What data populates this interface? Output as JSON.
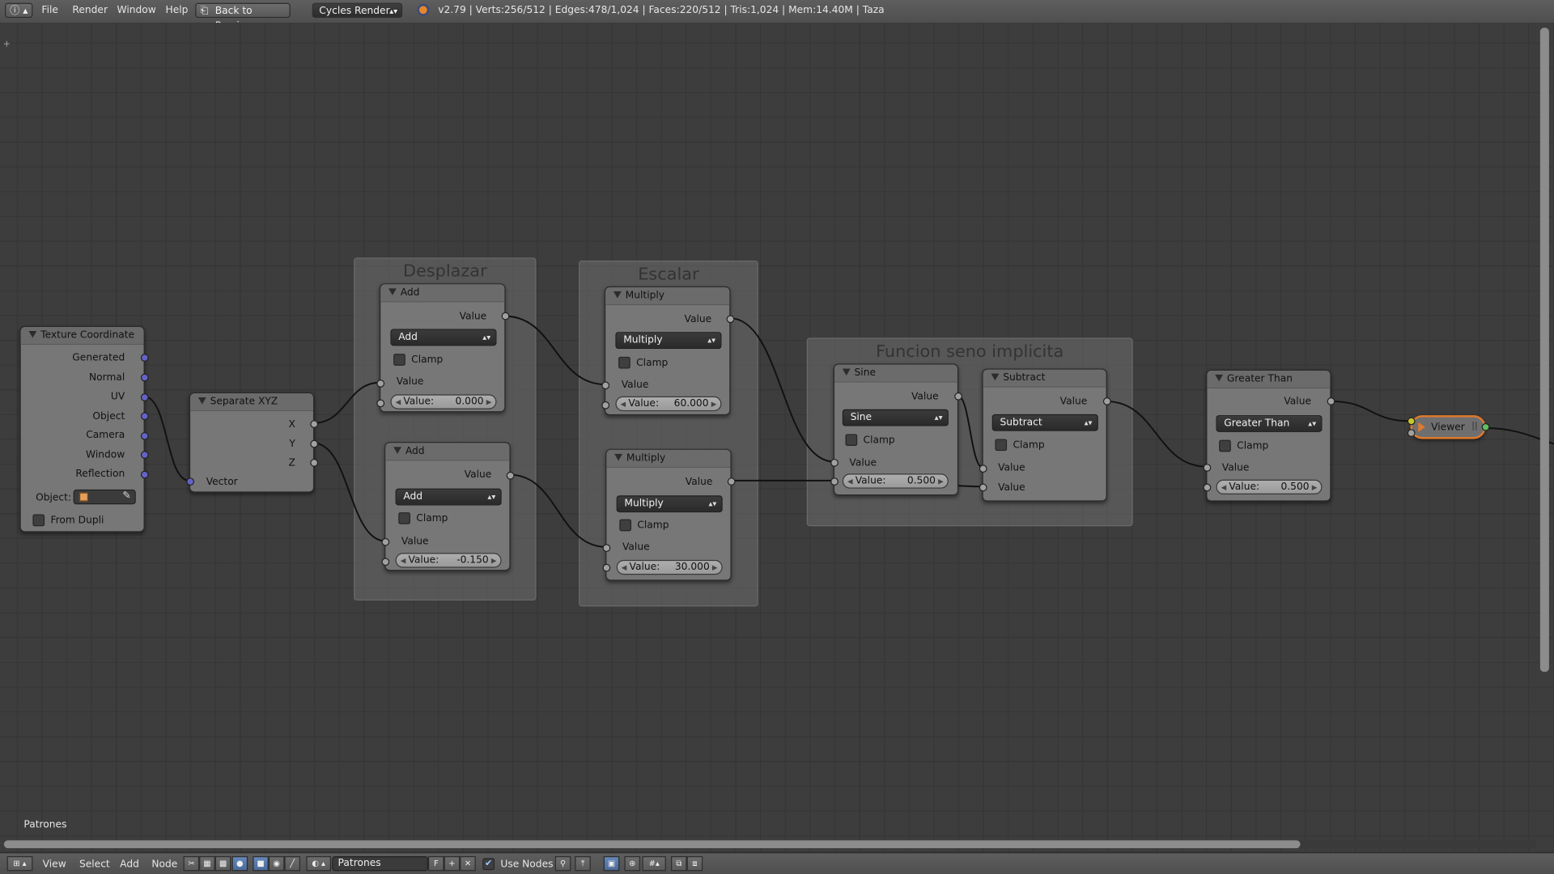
{
  "colors": {
    "canvas_bg": "#3d3d3d",
    "node_body": "#777777",
    "socket_value": "#a1a1a1",
    "socket_vector": "#6363c7",
    "viewer_outline": "#e07a2c",
    "wire": "#111111"
  },
  "top_bar": {
    "info_icon": "info-icon",
    "menus": [
      "File",
      "Render",
      "Window",
      "Help"
    ],
    "back_button": "Back to Previous",
    "render_engine": "Cycles Render",
    "blender_icon": "blender-logo-icon",
    "status": "v2.79 | Verts:256/512 | Edges:478/1,024 | Faces:220/512 | Tris:1,024 | Mem:14.40M | Taza"
  },
  "frames": {
    "desplazar": "Desplazar",
    "escalar": "Escalar",
    "funcion": "Funcion seno implicita"
  },
  "nodes": {
    "texture_coordinate": {
      "title": "Texture Coordinate",
      "outputs": [
        "Generated",
        "Normal",
        "UV",
        "Object",
        "Camera",
        "Window",
        "Reflection"
      ],
      "object_label": "Object:",
      "from_dupli": "From Dupli"
    },
    "separate_xyz": {
      "title": "Separate XYZ",
      "outputs": [
        "X",
        "Y",
        "Z"
      ],
      "input": "Vector"
    },
    "add1": {
      "title": "Add",
      "output": "Value",
      "operation": "Add",
      "clamp": "Clamp",
      "in1": "Value",
      "in2_label": "Value:",
      "in2_value": "0.000"
    },
    "add2": {
      "title": "Add",
      "output": "Value",
      "operation": "Add",
      "clamp": "Clamp",
      "in1": "Value",
      "in2_label": "Value:",
      "in2_value": "-0.150"
    },
    "mult1": {
      "title": "Multiply",
      "output": "Value",
      "operation": "Multiply",
      "clamp": "Clamp",
      "in1": "Value",
      "in2_label": "Value:",
      "in2_value": "60.000"
    },
    "mult2": {
      "title": "Multiply",
      "output": "Value",
      "operation": "Multiply",
      "clamp": "Clamp",
      "in1": "Value",
      "in2_label": "Value:",
      "in2_value": "30.000"
    },
    "sine": {
      "title": "Sine",
      "output": "Value",
      "operation": "Sine",
      "clamp": "Clamp",
      "in1": "Value",
      "in2_label": "Value:",
      "in2_value": "0.500"
    },
    "subtract": {
      "title": "Subtract",
      "output": "Value",
      "operation": "Subtract",
      "clamp": "Clamp",
      "in1": "Value",
      "in2": "Value"
    },
    "greater": {
      "title": "Greater Than",
      "output": "Value",
      "operation": "Greater Than",
      "clamp": "Clamp",
      "in1": "Value",
      "in2_label": "Value:",
      "in2_value": "0.500"
    },
    "viewer": {
      "title": "Viewer"
    }
  },
  "node_tree_label": "Patrones",
  "bottom_bar": {
    "editor_icon": "node-editor-icon",
    "menus": [
      "View",
      "Select",
      "Add",
      "Node"
    ],
    "tree_name": "Patrones",
    "fake_user": "F",
    "use_nodes": "Use Nodes",
    "use_nodes_checked": true
  }
}
